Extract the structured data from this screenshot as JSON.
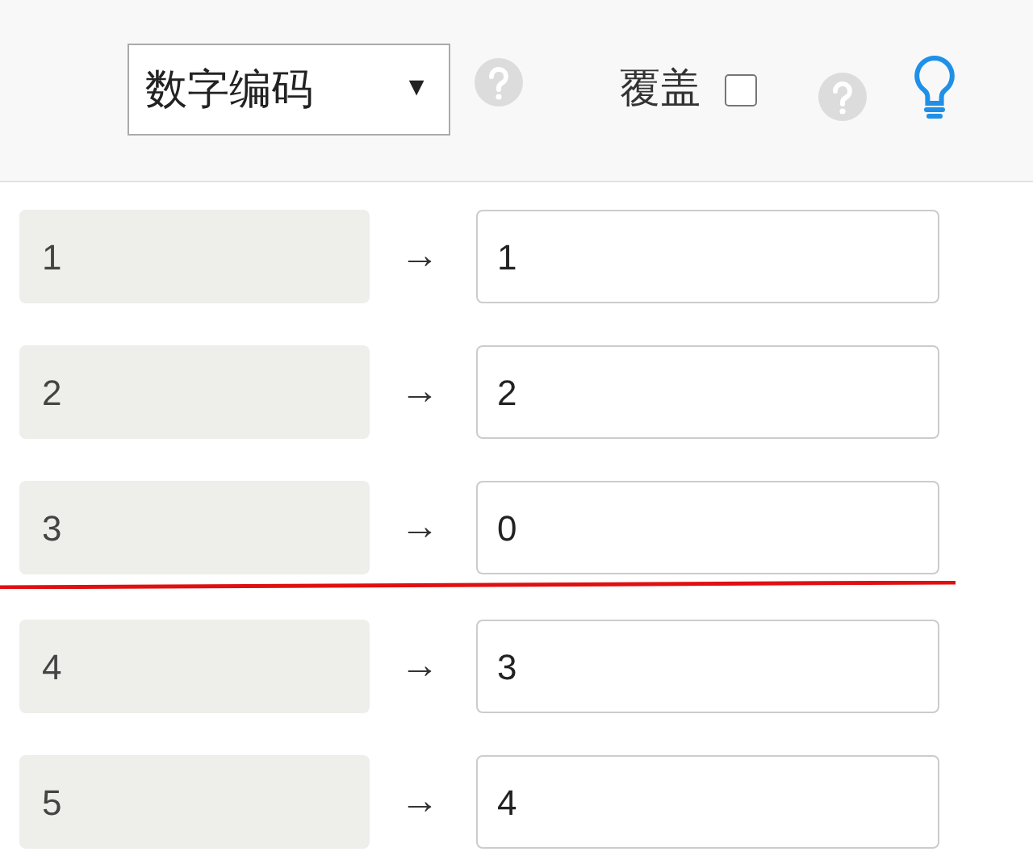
{
  "toolbar": {
    "encoding_select": {
      "value": "数字编码",
      "caret": "▼"
    },
    "overwrite": {
      "label": "覆盖",
      "checked": false
    }
  },
  "rows": [
    {
      "source": "1",
      "arrow": "→",
      "target": "1",
      "underlined": false
    },
    {
      "source": "2",
      "arrow": "→",
      "target": "2",
      "underlined": false
    },
    {
      "source": "3",
      "arrow": "→",
      "target": "0",
      "underlined": true
    },
    {
      "source": "4",
      "arrow": "→",
      "target": "3",
      "underlined": false
    },
    {
      "source": "5",
      "arrow": "→",
      "target": "4",
      "underlined": false
    }
  ]
}
